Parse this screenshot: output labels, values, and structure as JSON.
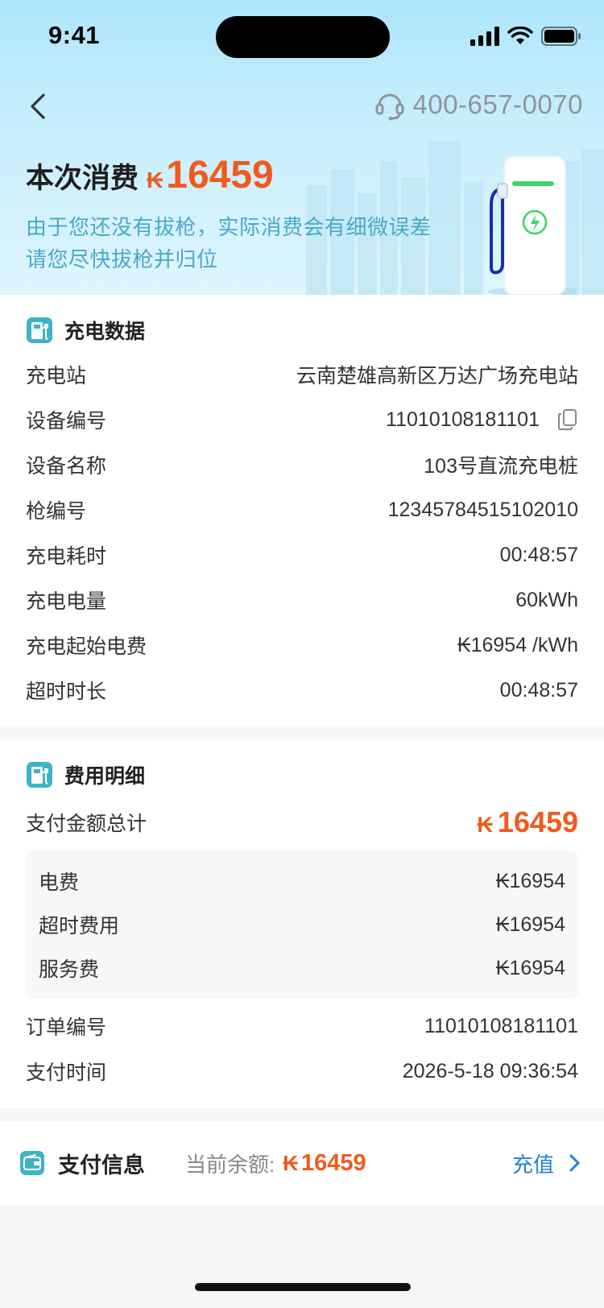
{
  "status_bar": {
    "time": "9:41"
  },
  "nav": {
    "hotline": "400-657-0070"
  },
  "header": {
    "consume_label": "本次消费",
    "currency": "₭",
    "amount": "16459",
    "note_line1": "由于您还没有拔枪，实际消费会有细微误差",
    "note_line2": "请您尽快拔枪并归位"
  },
  "charging_data": {
    "title": "充电数据",
    "rows": [
      {
        "label": "充电站",
        "value": "云南楚雄高新区万达广场充电站"
      },
      {
        "label": "设备编号",
        "value": "11010108181101"
      },
      {
        "label": "设备名称",
        "value": "103号直流充电桩"
      },
      {
        "label": "枪编号",
        "value": "12345784515102010"
      },
      {
        "label": "充电耗时",
        "value": "00:48:57"
      },
      {
        "label": "充电电量",
        "value": "60kWh"
      },
      {
        "label": "充电起始电费",
        "value": "₭16954 /kWh"
      },
      {
        "label": "超时时长",
        "value": "00:48:57"
      }
    ]
  },
  "fee_detail": {
    "title": "费用明细",
    "total_label": "支付金额总计",
    "total_currency": "₭",
    "total_amount": "16459",
    "items": [
      {
        "label": "电费",
        "value": "₭16954"
      },
      {
        "label": "超时费用",
        "value": "₭16954"
      },
      {
        "label": "服务费",
        "value": "₭16954"
      }
    ],
    "order_label": "订单编号",
    "order_value": "11010108181101",
    "time_label": "支付时间",
    "time_value": "2026-5-18 09:36:54"
  },
  "payment": {
    "title": "支付信息",
    "balance_label": "当前余额:",
    "balance_currency": "₭",
    "balance_amount": "16459",
    "recharge_label": "充值"
  },
  "colors": {
    "accent_orange": "#f05a1e",
    "link_blue": "#1e7fe0",
    "icon_teal": "#3fb3c4",
    "note_blue": "#4aa9c8"
  }
}
